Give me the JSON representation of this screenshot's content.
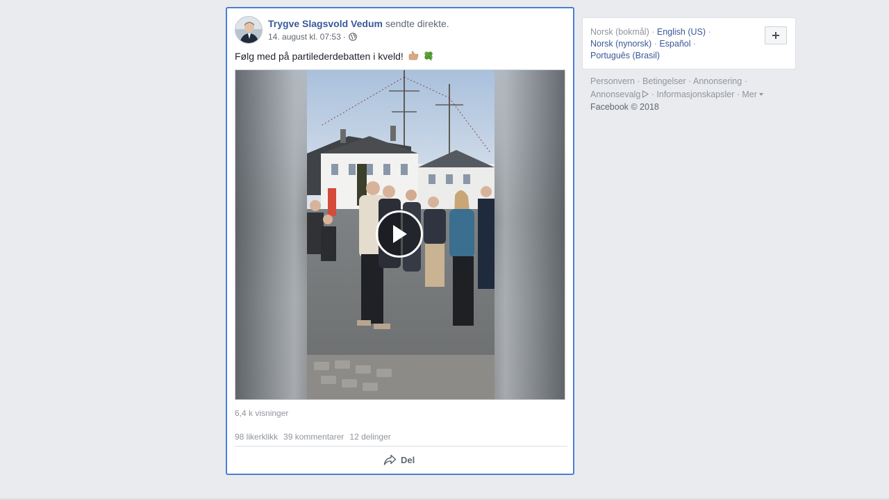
{
  "post": {
    "author_name": "Trygve Slagsvold Vedum",
    "action_text": "sendte direkte.",
    "timestamp": "14. august kl. 07:53",
    "separator": "·",
    "audience_icon": "globe-icon",
    "text": "Følg med på partilederdebatten i kveld!",
    "emojis": [
      "thumb-emoji",
      "four-leaf-clover-emoji"
    ],
    "views": "6,4 k visninger",
    "likes": "98 likerklikk",
    "comments": "39 kommentarer",
    "shares": "12 delinger",
    "share_label": "Del"
  },
  "sidebar": {
    "languages": [
      {
        "label": "Norsk (bokmål)",
        "current": true
      },
      {
        "label": "English (US)",
        "current": false
      },
      {
        "label": "Norsk (nynorsk)",
        "current": false
      },
      {
        "label": "Español",
        "current": false
      },
      {
        "label": "Português (Brasil)",
        "current": false
      }
    ],
    "add_language_icon": "plus-icon",
    "footer_links": [
      "Personvern",
      "Betingelser",
      "Annonsering",
      "Annonsevalg",
      "Informasjonskapsler",
      "Mer"
    ],
    "copyright": "Facebook © 2018"
  },
  "colors": {
    "link": "#385898",
    "muted": "#90949c",
    "focus_border": "#4a7ed6",
    "page_bg": "#e9ebee"
  }
}
